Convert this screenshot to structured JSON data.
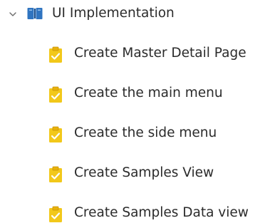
{
  "tree": {
    "group": {
      "label": "UI Implementation",
      "expanded": true,
      "chevron_icon": "chevron-down-icon",
      "icon": "book-icon",
      "icon_color": "#2f74c0"
    },
    "tasks": [
      {
        "label": "Create Master Detail Page",
        "icon": "clipboard-check-icon"
      },
      {
        "label": "Create the main menu",
        "icon": "clipboard-check-icon"
      },
      {
        "label": "Create the side menu",
        "icon": "clipboard-check-icon"
      },
      {
        "label": "Create Samples View",
        "icon": "clipboard-check-icon"
      },
      {
        "label": "Create Samples Data view",
        "icon": "clipboard-check-icon"
      }
    ],
    "task_icon_color": "#f2c81a"
  }
}
